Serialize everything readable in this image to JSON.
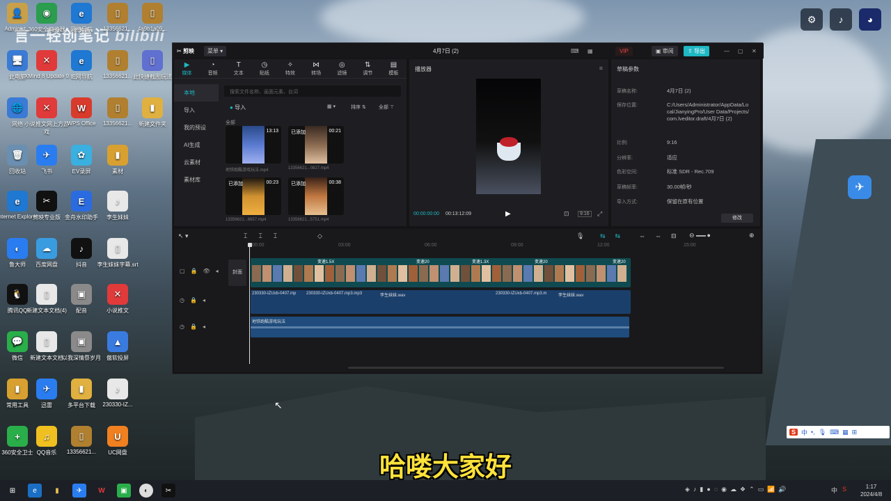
{
  "watermark": "言一轻创笔记",
  "watermark_logo": "bilibili",
  "desktop_icons": [
    {
      "label": "Administ...",
      "glyph": "👤",
      "color": "#c9a04a"
    },
    {
      "label": "360安全浏览器",
      "glyph": "◉",
      "color": "#2a9d4e"
    },
    {
      "label": "网络导航",
      "glyph": "e",
      "color": "#1f78d1"
    },
    {
      "label": "13356621...",
      "glyph": "▯",
      "color": "#b08030"
    },
    {
      "label": "此电脑",
      "glyph": "🖥",
      "color": "#3a7bd5"
    },
    {
      "label": "XMind 8 Update 9",
      "glyph": "✕",
      "color": "#e03a3a"
    },
    {
      "label": "IE网导航",
      "glyph": "e",
      "color": "#1f78d1"
    },
    {
      "label": "13356621...",
      "glyph": "▯",
      "color": "#b08030"
    },
    {
      "label": "4a9b1a09...",
      "glyph": "▯",
      "color": "#b08030"
    },
    {
      "label": "网络",
      "glyph": "🌐",
      "color": "#3a7bd5"
    },
    {
      "label": "小说推文网上方游戏",
      "glyph": "✕",
      "color": "#e03a3a"
    },
    {
      "label": "WPS Office",
      "glyph": "W",
      "color": "#d83b2b"
    },
    {
      "label": "13356621...",
      "glyph": "▯",
      "color": "#b08030"
    },
    {
      "label": "此快捷截图玩法",
      "glyph": "▯",
      "color": "#6070d0"
    },
    {
      "label": "回收站",
      "glyph": "🗑",
      "color": "#6a8fb0"
    },
    {
      "label": "飞书",
      "glyph": "✈",
      "color": "#2a7df0"
    },
    {
      "label": "EV录屏",
      "glyph": "✿",
      "color": "#3ab0e0"
    },
    {
      "label": "素材",
      "glyph": "▮",
      "color": "#d8a030"
    },
    {
      "label": "新建文件夹",
      "glyph": "▮",
      "color": "#e0b040"
    },
    {
      "label": "Internet Explorer",
      "glyph": "e",
      "color": "#1f78d1"
    },
    {
      "label": "剪映专业版",
      "glyph": "✂",
      "color": "#111111"
    },
    {
      "label": "金舟水印助手",
      "glyph": "E",
      "color": "#2a6be0"
    },
    {
      "label": "李生妹妹",
      "glyph": "♪",
      "color": "#e8e8e8"
    },
    {
      "label": "鲁大师",
      "glyph": "◐",
      "color": "#2a7df0"
    },
    {
      "label": "百度网盘",
      "glyph": "☁",
      "color": "#3a9ce0"
    },
    {
      "label": "抖音",
      "glyph": "♪",
      "color": "#111111"
    },
    {
      "label": "李生妹妹字幕.srt",
      "glyph": "▯",
      "color": "#e8e8e8"
    },
    {
      "label": "腾讯QQ",
      "glyph": "🐧",
      "color": "#111111"
    },
    {
      "label": "新建文本文档(4)",
      "glyph": "▯",
      "color": "#e8e8e8"
    },
    {
      "label": "配音",
      "glyph": "▣",
      "color": "#8a8a8a"
    },
    {
      "label": "小说推文",
      "glyph": "✕",
      "color": "#e03a3a"
    },
    {
      "label": "微信",
      "glyph": "💬",
      "color": "#2aae4a"
    },
    {
      "label": "新建文本文档",
      "glyph": "▯",
      "color": "#e8e8e8"
    },
    {
      "label": "以我深情祭岁月",
      "glyph": "▣",
      "color": "#8a8a8a"
    },
    {
      "label": "傲软投屏",
      "glyph": "▲",
      "color": "#3a7be0"
    },
    {
      "label": "常用工具",
      "glyph": "▮",
      "color": "#d8a030"
    },
    {
      "label": "迅雷",
      "glyph": "✈",
      "color": "#2a7df0"
    },
    {
      "label": "多平台下载",
      "glyph": "▮",
      "color": "#e0b040"
    },
    {
      "label": "230330-IZ...",
      "glyph": "♪",
      "color": "#e8e8e8"
    },
    {
      "label": "360安全卫士",
      "glyph": "+",
      "color": "#2aae4a"
    },
    {
      "label": "QQ音乐",
      "glyph": "♫",
      "color": "#f0c020"
    },
    {
      "label": "13356621...",
      "glyph": "▯",
      "color": "#b08030"
    },
    {
      "label": "UC网盘",
      "glyph": "U",
      "color": "#f08020"
    }
  ],
  "app": {
    "name": "剪映",
    "menu": "菜单",
    "project_title": "4月7日 (2)",
    "vip": "VIP",
    "review_btn": "审阅",
    "export_btn": "导出",
    "tools": [
      {
        "label": "媒体",
        "glyph": "▶"
      },
      {
        "label": "音频",
        "glyph": "◔"
      },
      {
        "label": "文本",
        "glyph": "T"
      },
      {
        "label": "贴纸",
        "glyph": "◷"
      },
      {
        "label": "特效",
        "glyph": "✧"
      },
      {
        "label": "转场",
        "glyph": "⋈"
      },
      {
        "label": "滤镜",
        "glyph": "◎"
      },
      {
        "label": "调节",
        "glyph": "⇅"
      },
      {
        "label": "模板",
        "glyph": "▤"
      }
    ],
    "side_items": [
      "本地",
      "导入",
      "我的预设",
      "AI生成",
      "云素材",
      "素材库"
    ],
    "search_placeholder": "搜索文件名称、画面元素、台词",
    "import_label": "导入",
    "sort_label": "排序",
    "all_label": "全部",
    "all_section": "全部",
    "media": [
      {
        "name": "地铁跑酷游戏玩法.mp4",
        "duration": "13:13",
        "added": ""
      },
      {
        "name": "13356621...0827.mp4",
        "duration": "00:21",
        "added": "已添加"
      },
      {
        "name": "13356621...6657.mp4",
        "duration": "00:23",
        "added": "已添加"
      },
      {
        "name": "13356621...5751.mp4",
        "duration": "00:38",
        "added": "已添加"
      }
    ],
    "player": {
      "title": "播放器",
      "current_time": "00:00:00:00",
      "total_time": "00:13:12:09",
      "ratio_btn": "比例"
    },
    "draft": {
      "title": "草稿参数",
      "rows": [
        {
          "k": "草稿名称:",
          "v": "4月7日 (2)"
        },
        {
          "k": "保存位置:",
          "v": "C:/Users/Administrator/AppData/Local/JianyingPro/User Data/Projects/com.lveditor.draft/4月7日 (2)"
        },
        {
          "k": "比例:",
          "v": "9:16"
        },
        {
          "k": "分辨率:",
          "v": "适应"
        },
        {
          "k": "色彩空间:",
          "v": "标准 SDR - Rec.709"
        },
        {
          "k": "草稿帧率:",
          "v": "30.00帧/秒"
        },
        {
          "k": "导入方式:",
          "v": "保留在原有位置"
        }
      ],
      "modify_btn": "修改"
    },
    "timeline": {
      "ruler": [
        "00:00",
        "03:00",
        "06:00",
        "09:00",
        "12:00",
        "15:00"
      ],
      "cover_label": "封面",
      "audio_clips": [
        "230330-IZUxb-0407.mp",
        "230330-IZUxb-0407.mp3.mp3",
        "李生妹妹.wav",
        "230330-IZUxb-0407.mp3.m",
        "李生妹妹.wav"
      ],
      "bg_track_label": "地铁跑酷游戏玩法",
      "clip_labels": [
        "变速1.5X",
        "变速20",
        "变速1.3X",
        "变速20",
        "变速20"
      ]
    }
  },
  "subtitle": "哈喽大家好",
  "ime_label": "中",
  "clock": {
    "time": "1:17",
    "date": "2024/4/8"
  }
}
